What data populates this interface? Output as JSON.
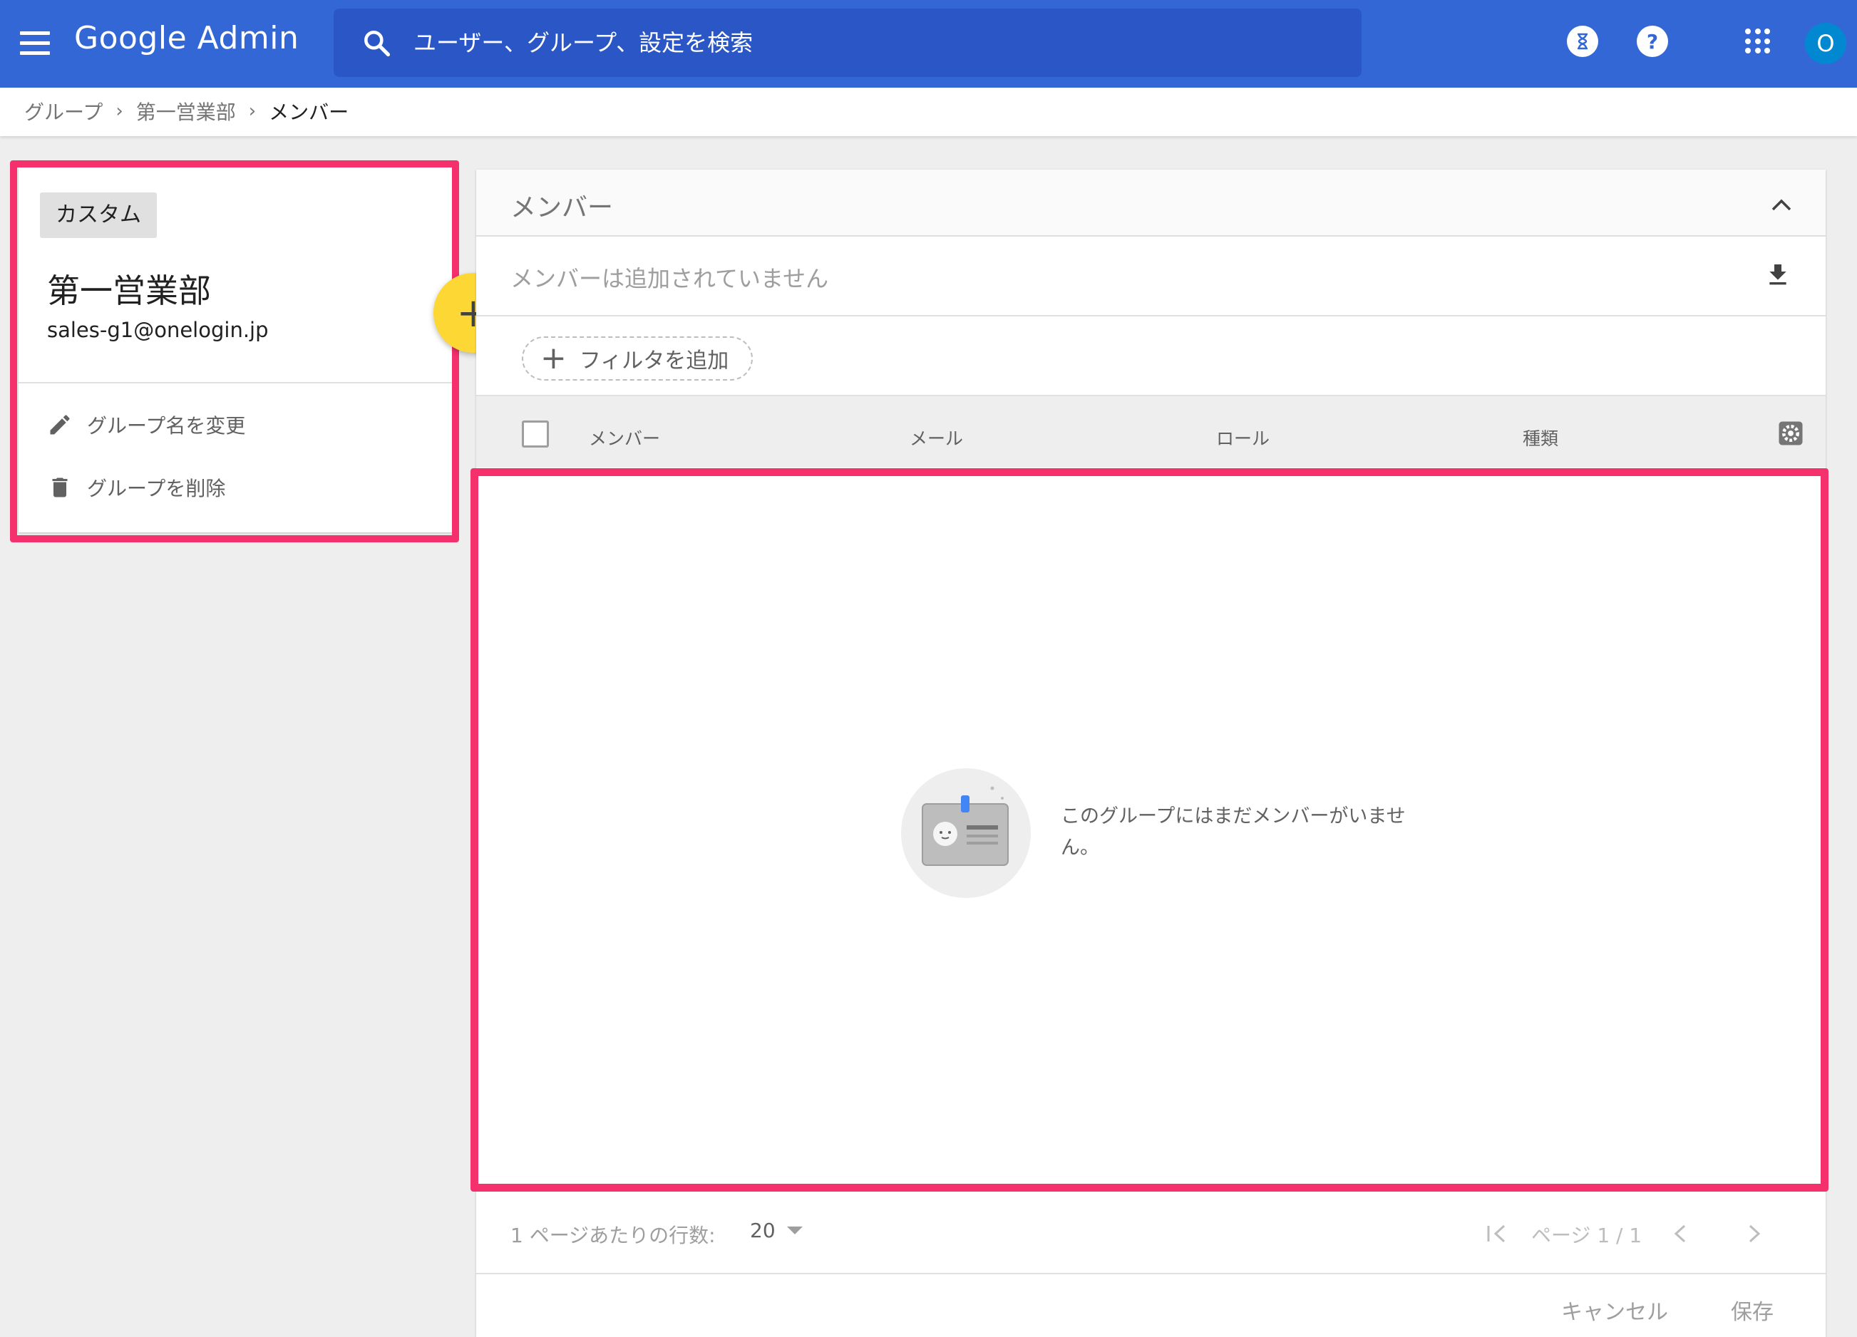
{
  "header": {
    "brand": "Google Admin",
    "search_placeholder": "ユーザー、グループ、設定を検索",
    "help_label": "?",
    "avatar_initial": "O"
  },
  "breadcrumb": {
    "items": [
      "グループ",
      "第一営業部",
      "メンバー"
    ],
    "separator": "›"
  },
  "group": {
    "type_chip": "カスタム",
    "name": "第一営業部",
    "email": "sales-g1@onelogin.jp",
    "actions": {
      "rename": "グループ名を変更",
      "delete": "グループを削除"
    },
    "fab_label": "+"
  },
  "members": {
    "section_title": "メンバー",
    "empty_summary": "メンバーは追加されていません",
    "filter_label": "フィルタを追加",
    "columns": [
      "メンバー",
      "メール",
      "ロール",
      "種類"
    ],
    "empty_message": "このグループにはまだメンバーがいません。"
  },
  "pagination": {
    "rows_per_page_label": "1 ページあたりの行数:",
    "rows_per_page_value": "20",
    "page_label": "ページ 1 / 1"
  },
  "footer": {
    "cancel_label": "キャンセル",
    "save_label": "保存"
  },
  "colors": {
    "topbar": "#3367d6",
    "highlight": "#f4306d",
    "fab": "#fdd835"
  }
}
